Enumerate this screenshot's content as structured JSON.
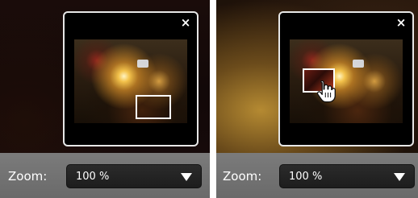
{
  "panels": [
    {
      "close_icon": "close-icon",
      "close_glyph": "×",
      "zoom": {
        "label": "Zoom:",
        "value": "100 %"
      }
    },
    {
      "close_icon": "close-icon",
      "close_glyph": "×",
      "cursor_icon": "hand-cursor-icon",
      "zoom": {
        "label": "Zoom:",
        "value": "100 %"
      }
    }
  ],
  "colors": {
    "frame_border": "#e7e7e7",
    "toolbar": "#6f6f6f",
    "select_bg": "#222222",
    "text": "#ffffff"
  }
}
